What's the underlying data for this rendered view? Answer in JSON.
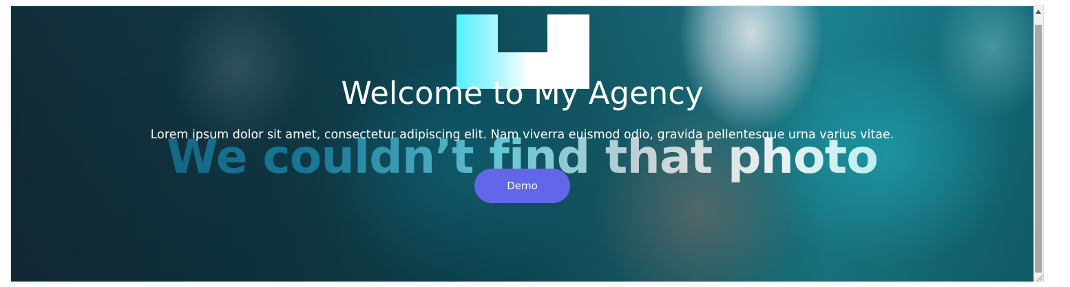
{
  "hero": {
    "title": "Welcome to My Agency",
    "subtitle": "Lorem ipsum dolor sit amet, consectetur adipiscing elit. Nam viverra euismod odio, gravida pellentesque urna varius vitae.",
    "button_label": "Demo",
    "button_color": "#6366e8",
    "background_image": {
      "placeholder_text": "We couldn’t find that photo",
      "icon": "broken-image-logo-icon"
    }
  },
  "scrollbar": {
    "up_icon": "scroll-up-arrow-icon",
    "resize_icon": "resize-grip-icon"
  }
}
